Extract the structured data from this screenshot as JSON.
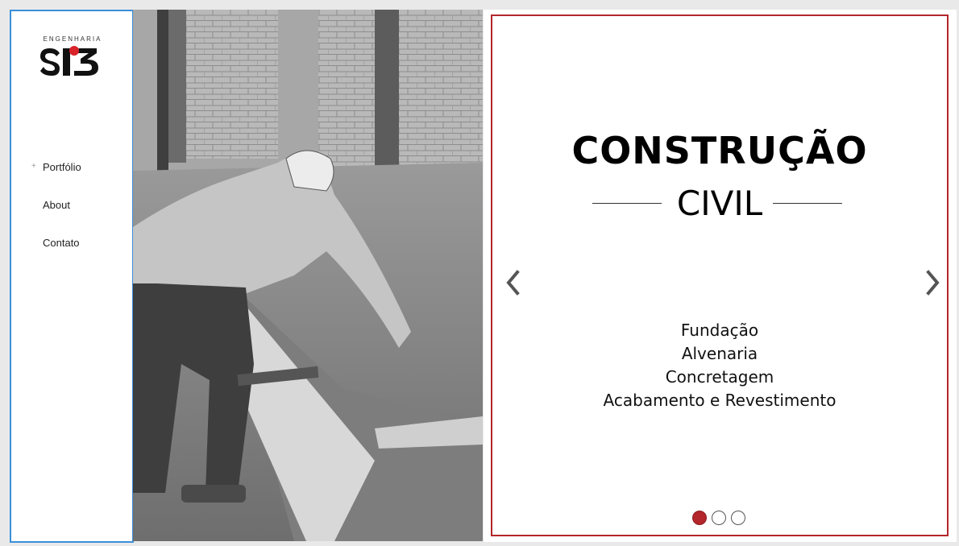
{
  "brand": {
    "company_word": "ENGENHARIA",
    "logo_text": "SI3"
  },
  "nav": {
    "items": [
      {
        "label": "Portfólio",
        "bullet": "+"
      },
      {
        "label": "About",
        "bullet": ""
      },
      {
        "label": "Contato",
        "bullet": ""
      }
    ]
  },
  "hero": {
    "photo_description_icon": "construction-worker-photo",
    "title": "CONSTRUÇÃO",
    "subtitle": "CIVIL",
    "services": [
      "Fundação",
      "Alvenaria",
      "Concretagem",
      "Acabamento e Revestimento"
    ],
    "prev_icon": "chevron-left-icon",
    "next_icon": "chevron-right-icon",
    "slides_total": 3,
    "slide_active": 1
  },
  "colors": {
    "accent_red": "#b3262b",
    "sidebar_border": "#3b8fd8"
  }
}
